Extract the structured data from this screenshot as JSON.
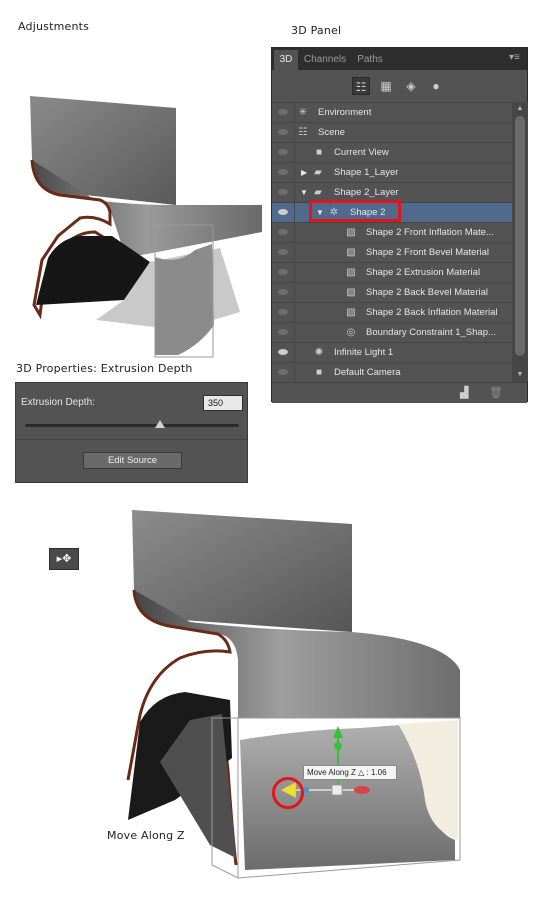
{
  "captions": {
    "adjustments": "Adjustments",
    "panel_3d": "3D Panel",
    "properties": "3D Properties: Extrusion Depth",
    "move_along_z": "Move Along Z"
  },
  "panel": {
    "tabs": [
      "3D",
      "Channels",
      "Paths"
    ],
    "toolbar_icons": [
      "scene-icon",
      "mesh-icon",
      "materials-icon",
      "lights-icon"
    ],
    "rows": [
      {
        "label": "Environment",
        "icon": "environment-icon"
      },
      {
        "label": "Scene",
        "icon": "scene-icon"
      },
      {
        "label": "Current View",
        "icon": "camera-icon"
      },
      {
        "label": "Shape 1_Layer",
        "icon": "folder-icon"
      },
      {
        "label": "Shape 2_Layer",
        "icon": "folder-icon"
      },
      {
        "label": "Shape 2",
        "icon": "mesh-icon"
      },
      {
        "label": "Shape 2 Front Inflation Mate...",
        "icon": "material-icon"
      },
      {
        "label": "Shape 2 Front Bevel Material",
        "icon": "material-icon"
      },
      {
        "label": "Shape 2 Extrusion Material",
        "icon": "material-icon"
      },
      {
        "label": "Shape 2 Back Bevel Material",
        "icon": "material-icon"
      },
      {
        "label": "Shape 2 Back Inflation Material",
        "icon": "material-icon"
      },
      {
        "label": "Boundary Constraint 1_Shap...",
        "icon": "constraint-icon"
      },
      {
        "label": "Infinite Light 1",
        "icon": "light-icon"
      },
      {
        "label": "Default Camera",
        "icon": "camera-icon"
      }
    ]
  },
  "properties": {
    "label": "Extrusion Depth:",
    "value": "350",
    "slider_fraction": 0.63,
    "button": "Edit Source"
  },
  "tooltip": {
    "text": "Move Along Z",
    "delta_symbol": "△",
    "value": ": 1.06"
  },
  "colors": {
    "panel_bg": "#535353",
    "selection": "#4f6a8c",
    "highlight": "#e0161b",
    "chair_edge": "#6b2a16"
  }
}
